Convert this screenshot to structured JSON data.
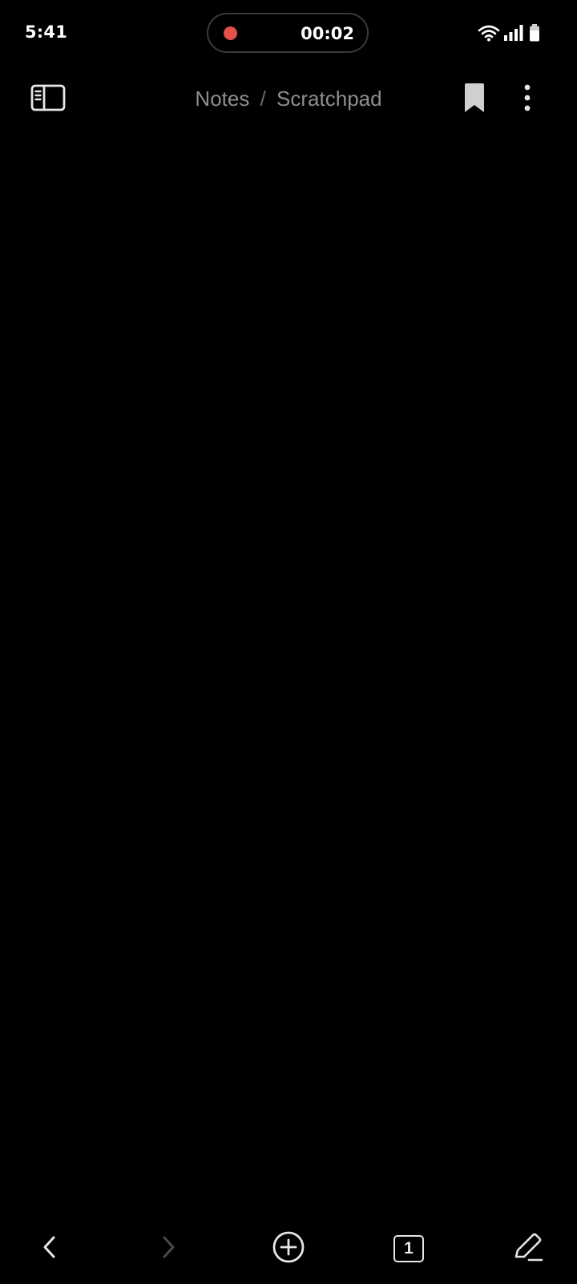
{
  "status_bar": {
    "time": "5:41",
    "recording_timer": "00:02",
    "recording_color": "#e5504b"
  },
  "header": {
    "breadcrumb_parent": "Notes",
    "breadcrumb_separator": "/",
    "breadcrumb_current": "Scratchpad",
    "icons": [
      "sidebar-toggle-icon",
      "bookmark-icon",
      "more-vertical-icon"
    ]
  },
  "editor": {
    "content": ""
  },
  "bottom_toolbar": {
    "tab_count": "1",
    "icons": [
      "back-arrow-icon",
      "forward-arrow-icon",
      "add-circle-icon",
      "tab-count-icon",
      "edit-pen-icon"
    ]
  },
  "colors": {
    "background": "#000000",
    "icon_primary": "#e6e6e6",
    "icon_disabled": "#4a4a4a",
    "breadcrumb_text": "#8e8e8e"
  }
}
